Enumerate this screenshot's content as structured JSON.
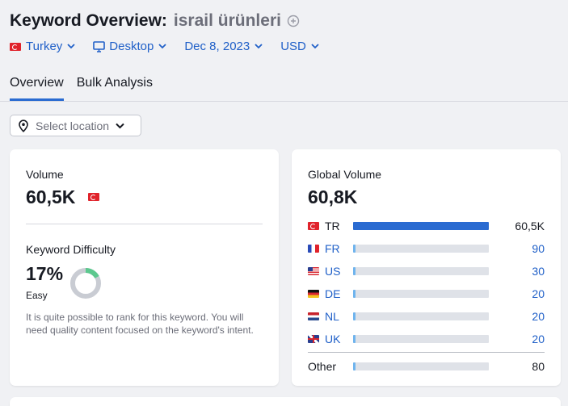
{
  "header": {
    "title": "Keyword Overview:",
    "keyword": "israil ürünleri"
  },
  "filters": {
    "country": "Turkey",
    "device": "Desktop",
    "date": "Dec 8, 2023",
    "currency": "USD"
  },
  "tabs": [
    {
      "label": "Overview"
    },
    {
      "label": "Bulk Analysis"
    }
  ],
  "location_select": {
    "placeholder": "Select location"
  },
  "volume_card": {
    "label": "Volume",
    "value": "60,5K",
    "kd_label": "Keyword Difficulty",
    "kd_value": "17%",
    "kd_level": "Easy",
    "kd_percent": 17,
    "kd_color": "#5cc88e",
    "description": "It is quite possible to rank for this keyword. You will need quality content focused on the keyword's intent."
  },
  "global_card": {
    "label": "Global Volume",
    "value": "60,8K",
    "rows": [
      {
        "code": "TR",
        "value": "60,5K",
        "fraction": 1.0
      },
      {
        "code": "FR",
        "value": "90",
        "fraction": 0.0015
      },
      {
        "code": "US",
        "value": "30",
        "fraction": 0.0005
      },
      {
        "code": "DE",
        "value": "20",
        "fraction": 0.0003
      },
      {
        "code": "NL",
        "value": "20",
        "fraction": 0.0003
      },
      {
        "code": "UK",
        "value": "20",
        "fraction": 0.0003
      }
    ],
    "other": {
      "label": "Other",
      "value": "80",
      "fraction": 0.0013
    }
  },
  "colors": {
    "accent": "#2a6bd1",
    "link": "#2060c8",
    "bar_bg": "#dfe2e8"
  }
}
